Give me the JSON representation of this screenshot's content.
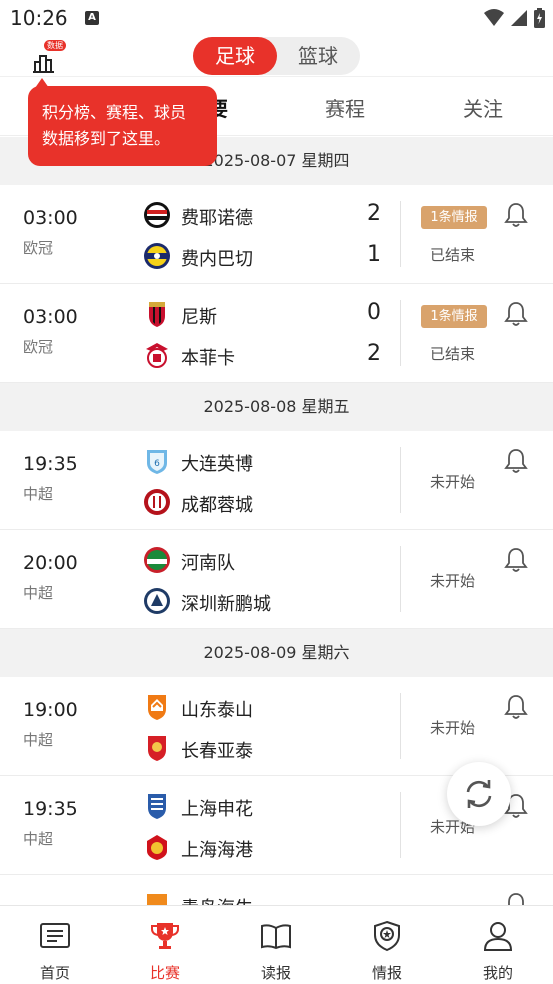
{
  "status_bar": {
    "time": "10:26",
    "notification_letter": "A"
  },
  "header": {
    "data_badge": "数据",
    "sport_tabs": [
      {
        "label": "足球",
        "active": true
      },
      {
        "label": "篮球",
        "active": false
      }
    ]
  },
  "tabs": [
    {
      "label": "重要",
      "active": true
    },
    {
      "label": "赛程",
      "active": false
    },
    {
      "label": "关注",
      "active": false
    }
  ],
  "tooltip": {
    "line1": "积分榜、赛程、球员",
    "line2": "数据移到了这里。"
  },
  "days": [
    {
      "date": "2025-08-07 星期四",
      "matches": [
        {
          "time": "03:00",
          "league": "欧冠",
          "home": "费耶诺德",
          "away": "费内巴切",
          "home_score": "2",
          "away_score": "1",
          "intel": "1条情报",
          "status": "已结束"
        },
        {
          "time": "03:00",
          "league": "欧冠",
          "home": "尼斯",
          "away": "本菲卡",
          "home_score": "0",
          "away_score": "2",
          "intel": "1条情报",
          "status": "已结束"
        }
      ]
    },
    {
      "date": "2025-08-08 星期五",
      "matches": [
        {
          "time": "19:35",
          "league": "中超",
          "home": "大连英博",
          "away": "成都蓉城",
          "status": "未开始"
        },
        {
          "time": "20:00",
          "league": "中超",
          "home": "河南队",
          "away": "深圳新鹏城",
          "status": "未开始"
        }
      ]
    },
    {
      "date": "2025-08-09 星期六",
      "matches": [
        {
          "time": "19:00",
          "league": "中超",
          "home": "山东泰山",
          "away": "长春亚泰",
          "status": "未开始"
        },
        {
          "time": "19:35",
          "league": "中超",
          "home": "上海申花",
          "away": "上海海港",
          "status": "未开始"
        },
        {
          "time": "",
          "league": "",
          "home": "青岛海牛",
          "away": "",
          "status": ""
        }
      ]
    }
  ],
  "bottom_nav": [
    {
      "label": "首页",
      "icon": "news-icon",
      "active": false
    },
    {
      "label": "比赛",
      "icon": "trophy-icon",
      "active": true
    },
    {
      "label": "读报",
      "icon": "book-icon",
      "active": false
    },
    {
      "label": "情报",
      "icon": "shield-star-icon",
      "active": false
    },
    {
      "label": "我的",
      "icon": "person-icon",
      "active": false
    }
  ],
  "colors": {
    "accent": "#e8322a",
    "intel_badge": "#d9a36c",
    "date_bg": "#f2f2f2"
  }
}
